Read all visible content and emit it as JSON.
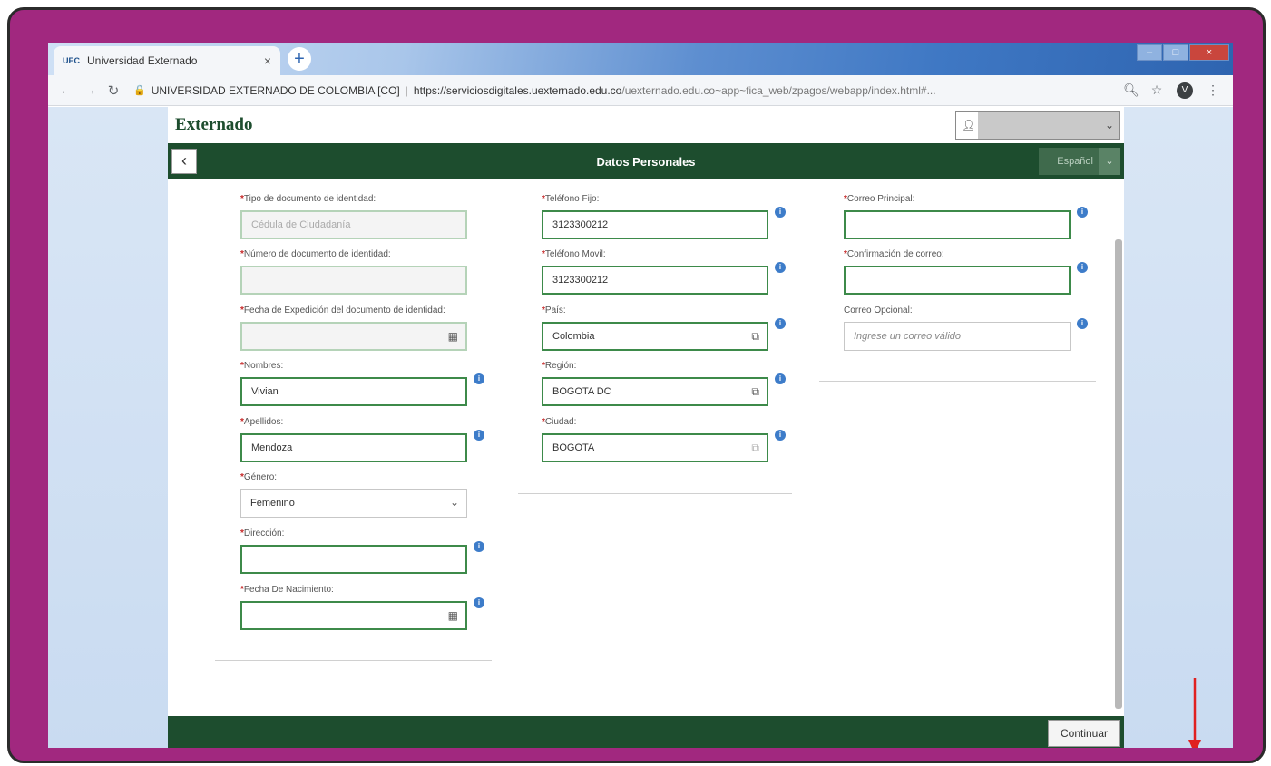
{
  "browser": {
    "tab_title": "Universidad Externado",
    "favicon_text": "UEC",
    "tab_close": "×",
    "new_tab": "+",
    "window_controls": [
      "–",
      "□",
      "×"
    ],
    "site_identity": "UNIVERSIDAD EXTERNADO DE COLOMBIA [CO]",
    "url_host": "https://serviciosdigitales.uexternado.edu.co",
    "url_path": "/uexternado.edu.co~app~fica_web/zpagos/webapp/index.html#...",
    "profile_initial": "V"
  },
  "app": {
    "logo_text": "Externado",
    "page_title": "Datos Personales",
    "language": "Español",
    "continue_label": "Continuar"
  },
  "form": {
    "col1": {
      "tipo_doc": {
        "label": "Tipo de documento de identidad:",
        "value": "Cédula de Ciudadanía"
      },
      "numero_doc": {
        "label": "Número de documento de identidad:",
        "value": ""
      },
      "fecha_exp": {
        "label": "Fecha de Expedición del documento de identidad:",
        "value": ""
      },
      "nombres": {
        "label": "Nombres:",
        "value": "Vivian"
      },
      "apellidos": {
        "label": "Apellidos:",
        "value": "Mendoza"
      },
      "genero": {
        "label": "Género:",
        "value": "Femenino"
      },
      "direccion": {
        "label": "Dirección:",
        "value": ""
      },
      "fecha_nac": {
        "label": "Fecha De Nacimiento:",
        "value": ""
      }
    },
    "col2": {
      "tel_fijo": {
        "label": "Teléfono Fijo:",
        "value": "3123300212"
      },
      "tel_movil": {
        "label": "Teléfono Movil:",
        "value": "3123300212"
      },
      "pais": {
        "label": "País:",
        "value": "Colombia"
      },
      "region": {
        "label": "Región:",
        "value": "BOGOTA DC"
      },
      "ciudad": {
        "label": "Ciudad:",
        "value": "BOGOTA"
      }
    },
    "col3": {
      "correo_principal": {
        "label": "Correo Principal:",
        "value": ""
      },
      "confirmacion": {
        "label": "Confirmación de correo:",
        "value": ""
      },
      "correo_opcional": {
        "label": "Correo Opcional:",
        "placeholder": "Ingrese un correo válido"
      }
    }
  },
  "colors": {
    "brand_green": "#1d4d2e",
    "frame_purple": "#a1287f",
    "required_red": "#c62828"
  }
}
